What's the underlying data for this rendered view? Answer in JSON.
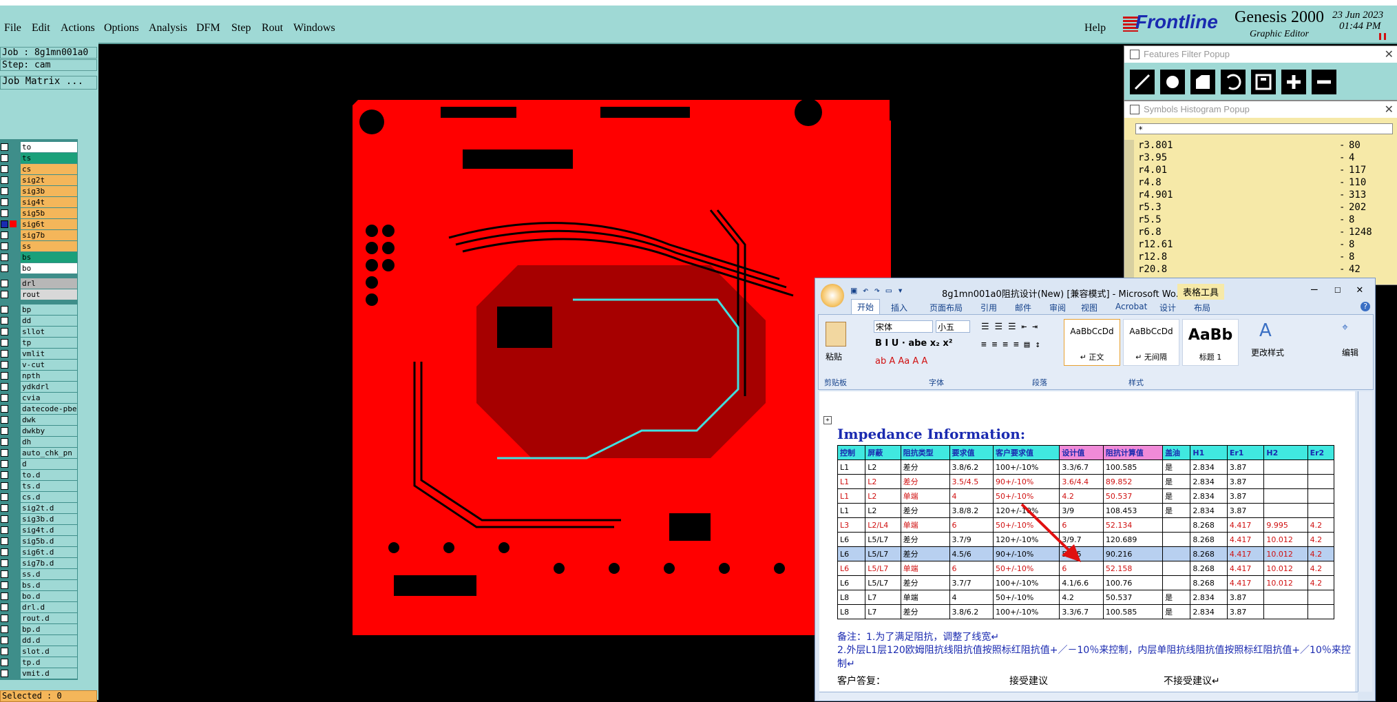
{
  "menu": {
    "items": [
      "File",
      "Edit",
      "Actions",
      "Options",
      "Analysis",
      "DFM",
      "Step",
      "Rout",
      "Windows"
    ],
    "help": "Help"
  },
  "brand": {
    "logo": "Frontline",
    "product": "Genesis 2000",
    "subtitle": "Graphic Editor",
    "date": "23 Jun 2023",
    "time": "01:44 PM"
  },
  "left": {
    "job": "Job : 8g1mn001a0",
    "step": "Step: cam",
    "matrix_button": "Job Matrix ...",
    "selected": "Selected : 0",
    "layers": [
      {
        "name": "to",
        "color": "#ffffff"
      },
      {
        "name": "ts",
        "color": "#1aa07a"
      },
      {
        "name": "cs",
        "color": "#f4b65a"
      },
      {
        "name": "sig2t",
        "color": "#f4b65a"
      },
      {
        "name": "sig3b",
        "color": "#f4b65a"
      },
      {
        "name": "sig4t",
        "color": "#f4b65a"
      },
      {
        "name": "sig5b",
        "color": "#f4b65a"
      },
      {
        "name": "sig6t",
        "color": "#f4b65a",
        "active": true
      },
      {
        "name": "sig7b",
        "color": "#f4b65a"
      },
      {
        "name": "ss",
        "color": "#f4b65a"
      },
      {
        "name": "bs",
        "color": "#1aa07a"
      },
      {
        "name": "bo",
        "color": "#ffffff"
      },
      {
        "name": "drl",
        "color": "#b7b7b7",
        "gap": true
      },
      {
        "name": "rout",
        "color": "#d8d8d8"
      },
      {
        "name": "bp",
        "color": "#9fd9d5",
        "gap": true
      },
      {
        "name": "dd",
        "color": "#9fd9d5"
      },
      {
        "name": "sllot",
        "color": "#9fd9d5"
      },
      {
        "name": "tp",
        "color": "#9fd9d5"
      },
      {
        "name": "vmlit",
        "color": "#9fd9d5"
      },
      {
        "name": "v-cut",
        "color": "#9fd9d5"
      },
      {
        "name": "npth",
        "color": "#9fd9d5"
      },
      {
        "name": "ydkdrl",
        "color": "#9fd9d5"
      },
      {
        "name": "cvia",
        "color": "#9fd9d5"
      },
      {
        "name": "datecode-pbe",
        "color": "#9fd9d5"
      },
      {
        "name": "dwk",
        "color": "#9fd9d5"
      },
      {
        "name": "dwkby",
        "color": "#9fd9d5"
      },
      {
        "name": "dh",
        "color": "#9fd9d5"
      },
      {
        "name": "auto_chk_pn",
        "color": "#9fd9d5"
      },
      {
        "name": "d",
        "color": "#9fd9d5"
      },
      {
        "name": "to.d",
        "color": "#9fd9d5"
      },
      {
        "name": "ts.d",
        "color": "#9fd9d5"
      },
      {
        "name": "cs.d",
        "color": "#9fd9d5"
      },
      {
        "name": "sig2t.d",
        "color": "#9fd9d5"
      },
      {
        "name": "sig3b.d",
        "color": "#9fd9d5"
      },
      {
        "name": "sig4t.d",
        "color": "#9fd9d5"
      },
      {
        "name": "sig5b.d",
        "color": "#9fd9d5"
      },
      {
        "name": "sig6t.d",
        "color": "#9fd9d5"
      },
      {
        "name": "sig7b.d",
        "color": "#9fd9d5"
      },
      {
        "name": "ss.d",
        "color": "#9fd9d5"
      },
      {
        "name": "bs.d",
        "color": "#9fd9d5"
      },
      {
        "name": "bo.d",
        "color": "#9fd9d5"
      },
      {
        "name": "drl.d",
        "color": "#9fd9d5"
      },
      {
        "name": "rout.d",
        "color": "#9fd9d5"
      },
      {
        "name": "bp.d",
        "color": "#9fd9d5"
      },
      {
        "name": "dd.d",
        "color": "#9fd9d5"
      },
      {
        "name": "slot.d",
        "color": "#9fd9d5"
      },
      {
        "name": "tp.d",
        "color": "#9fd9d5"
      },
      {
        "name": "vmit.d",
        "color": "#9fd9d5"
      }
    ]
  },
  "features_popup": {
    "title": "Features Filter Popup"
  },
  "symbols_popup": {
    "title": "Symbols Histogram Popup",
    "filter": "*",
    "rows": [
      {
        "sym": "r3.801",
        "cnt": "80"
      },
      {
        "sym": "r3.95",
        "cnt": "4"
      },
      {
        "sym": "r4.01",
        "cnt": "117"
      },
      {
        "sym": "r4.8",
        "cnt": "110"
      },
      {
        "sym": "r4.901",
        "cnt": "313"
      },
      {
        "sym": "r5.3",
        "cnt": "202"
      },
      {
        "sym": "r5.5",
        "cnt": "8"
      },
      {
        "sym": "r6.8",
        "cnt": "1248"
      },
      {
        "sym": "r12.61",
        "cnt": "8"
      },
      {
        "sym": "r12.8",
        "cnt": "8"
      },
      {
        "sym": "r20.8",
        "cnt": "42"
      }
    ]
  },
  "word": {
    "title": "8g1mn001a0阻抗设计(New) [兼容模式] - Microsoft Wo...",
    "context_tab": "表格工具",
    "tabs": [
      "开始",
      "插入",
      "页面布局",
      "引用",
      "邮件",
      "审阅",
      "视图",
      "Acrobat",
      "设计",
      "布局"
    ],
    "font_name": "宋体",
    "font_size": "小五",
    "groups": {
      "clipboard": "剪贴板",
      "font": "字体",
      "paragraph": "段落",
      "styles": "样式"
    },
    "paste": "粘贴",
    "styles": [
      {
        "preview": "AaBbCcDd",
        "name": "↵ 正文"
      },
      {
        "preview": "AaBbCcDd",
        "name": "↵ 无间隔"
      },
      {
        "preview": "AaBb",
        "name": "标题 1"
      }
    ],
    "change_styles": "更改样式",
    "edit": "编辑",
    "heading": "Impedance Information:",
    "headers": [
      "控制",
      "屏蔽",
      "阻抗类型",
      "要求值",
      "客户要求值",
      "设计值",
      "阻抗计算值",
      "盖油",
      "H1",
      "Er1",
      "H2",
      "Er2"
    ],
    "rows": [
      {
        "c": [
          "L1",
          "L2",
          "差分",
          "3.8/6.2",
          "100+/-10%",
          "3.3/6.7",
          "100.585",
          "是",
          "2.834",
          "3.87",
          "",
          ""
        ],
        "red": false
      },
      {
        "c": [
          "L1",
          "L2",
          "差分",
          "3.5/4.5",
          "90+/-10%",
          "3.6/4.4",
          "89.852",
          "是",
          "2.834",
          "3.87",
          "",
          ""
        ],
        "red": true
      },
      {
        "c": [
          "L1",
          "L2",
          "单端",
          "4",
          "50+/-10%",
          "4.2",
          "50.537",
          "是",
          "2.834",
          "3.87",
          "",
          ""
        ],
        "red": true
      },
      {
        "c": [
          "L1",
          "L2",
          "差分",
          "3.8/8.2",
          "120+/-10%",
          "3/9",
          "108.453",
          "是",
          "2.834",
          "3.87",
          "",
          ""
        ],
        "red": false
      },
      {
        "c": [
          "L3",
          "L2/L4",
          "单端",
          "6",
          "50+/-10%",
          "6",
          "52.134",
          "",
          "8.268",
          "4.417",
          "9.995",
          "4.2"
        ],
        "red": true
      },
      {
        "c": [
          "L6",
          "L5/L7",
          "差分",
          "3.7/9",
          "120+/-10%",
          "3/9.7",
          "120.689",
          "",
          "8.268",
          "4.417",
          "10.012",
          "4.2"
        ],
        "red": false
      },
      {
        "c": [
          "L6",
          "L5/L7",
          "差分",
          "4.5/6",
          "90+/-10%",
          "5/5.5",
          "90.216",
          "",
          "8.268",
          "4.417",
          "10.012",
          "4.2"
        ],
        "red": false,
        "selected": true
      },
      {
        "c": [
          "L6",
          "L5/L7",
          "单端",
          "6",
          "50+/-10%",
          "6",
          "52.158",
          "",
          "8.268",
          "4.417",
          "10.012",
          "4.2"
        ],
        "red": true
      },
      {
        "c": [
          "L6",
          "L5/L7",
          "差分",
          "3.7/7",
          "100+/-10%",
          "4.1/6.6",
          "100.76",
          "",
          "8.268",
          "4.417",
          "10.012",
          "4.2"
        ],
        "red": false
      },
      {
        "c": [
          "L8",
          "L7",
          "单端",
          "4",
          "50+/-10%",
          "4.2",
          "50.537",
          "是",
          "2.834",
          "3.87",
          "",
          ""
        ],
        "red": false
      },
      {
        "c": [
          "L8",
          "L7",
          "差分",
          "3.8/6.2",
          "100+/-10%",
          "3.3/6.7",
          "100.585",
          "是",
          "2.834",
          "3.87",
          "",
          ""
        ],
        "red": false
      }
    ],
    "note1": "备注：1.为了满足阻抗，调整了线宽↵",
    "note2": "2.外层L1层120欧姆阻抗线阻抗值按照标红阻抗值+／－10％来控制，内层单阻抗线阻抗值按照标红阻抗值+／10％来控制↵",
    "reply_label": "客户答复：",
    "accept": "接受建议",
    "reject": "不接受建议↵"
  },
  "colors": {
    "board": "#ff0000",
    "panel": "#9fd9d5",
    "accent": "#1a2ab0"
  }
}
